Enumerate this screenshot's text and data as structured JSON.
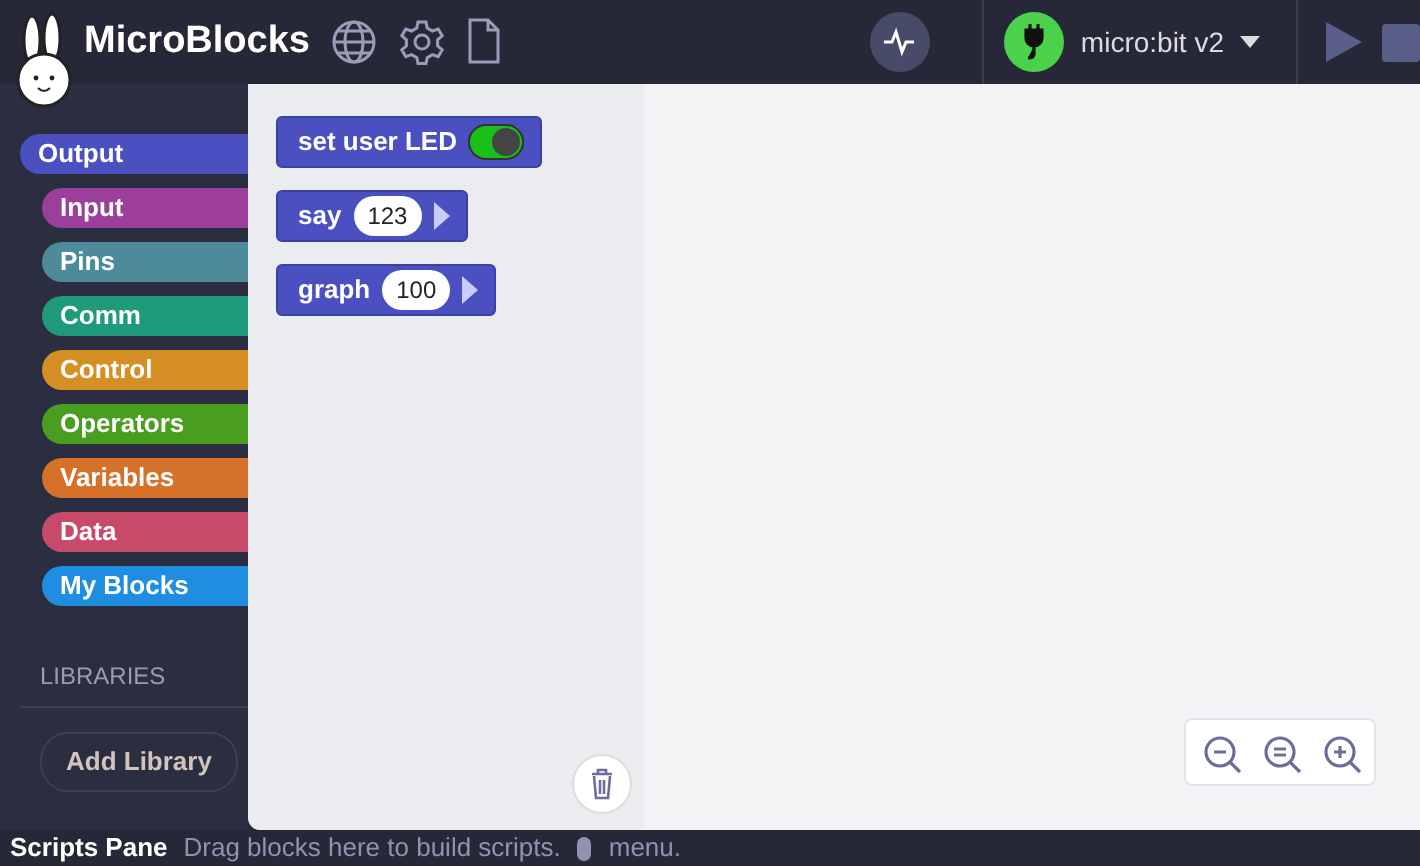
{
  "app": {
    "title": "MicroBlocks"
  },
  "device": {
    "name": "micro:bit v2",
    "connected": true
  },
  "categories": [
    {
      "label": "Output",
      "color": "#4a50c0",
      "selected": true
    },
    {
      "label": "Input",
      "color": "#9c3f9c",
      "selected": false
    },
    {
      "label": "Pins",
      "color": "#4d8a9a",
      "selected": false
    },
    {
      "label": "Comm",
      "color": "#1f9a7a",
      "selected": false
    },
    {
      "label": "Control",
      "color": "#d68f25",
      "selected": false
    },
    {
      "label": "Operators",
      "color": "#4a9e1f",
      "selected": false
    },
    {
      "label": "Variables",
      "color": "#d6712a",
      "selected": false
    },
    {
      "label": "Data",
      "color": "#c84a6a",
      "selected": false
    },
    {
      "label": "My Blocks",
      "color": "#1f8ee0",
      "selected": false
    }
  ],
  "libraries": {
    "heading": "LIBRARIES",
    "button": "Add Library"
  },
  "blocks": [
    {
      "kind": "toggle",
      "label": "set user LED",
      "on": true
    },
    {
      "kind": "input",
      "label": "say",
      "value": "123"
    },
    {
      "kind": "input",
      "label": "graph",
      "value": "100"
    }
  ],
  "status_bar": {
    "title": "Scripts Pane",
    "hint": "Drag blocks here to build scripts.",
    "menu": "menu."
  }
}
